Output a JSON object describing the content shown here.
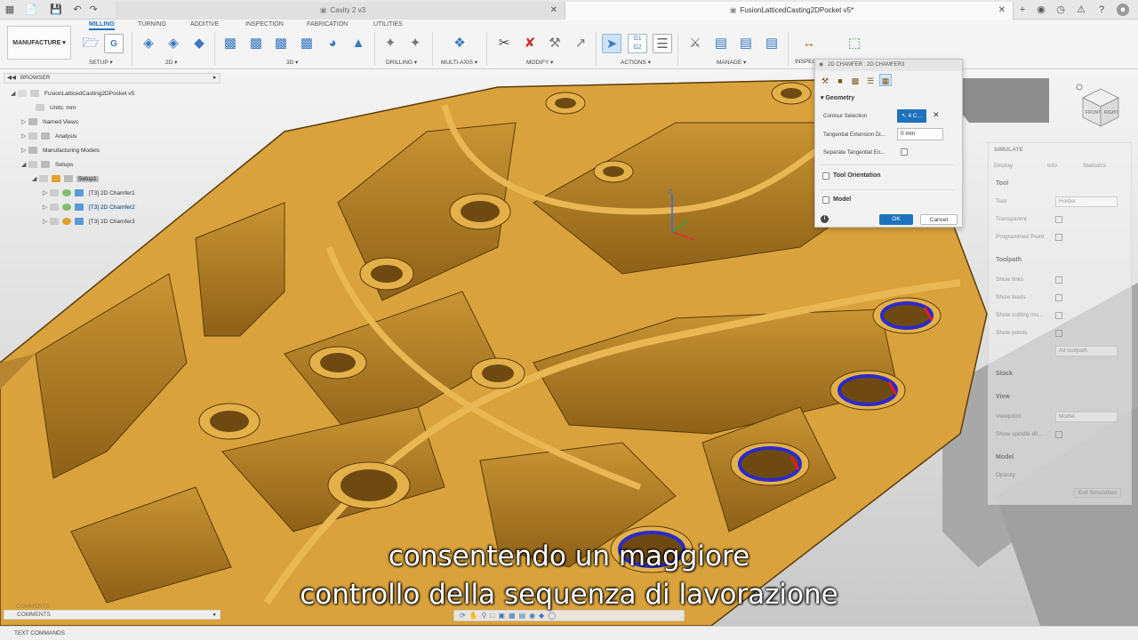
{
  "titlebar": {
    "inactive_tab": "Cavity 2 v3",
    "active_tab": "FusionLatticedCasting2DPocket v5*"
  },
  "ribbon": {
    "tabs": [
      "MILLING",
      "TURNING",
      "ADDITIVE",
      "INSPECTION",
      "FABRICATION",
      "UTILITIES"
    ],
    "workspace": "MANUFACTURE",
    "groups": [
      "SETUP",
      "2D",
      "3D",
      "DRILLING",
      "MULTI-AXIS",
      "MODIFY",
      "ACTIONS",
      "MANAGE",
      "INSPECT"
    ]
  },
  "browser": {
    "header": "BROWSER",
    "items": [
      "FusionLatticedCasting2DPocket v5",
      "Units: mm",
      "Named Views",
      "Analysis",
      "Manufacturing Models",
      "Setups",
      "Setup1",
      "[T3] 2D Chamfer1",
      "[T3] 2D Chamfer2",
      "[T3] 2D Chamfer3"
    ]
  },
  "dialog": {
    "title": "2D CHAMFER : 2D CHAMFER3",
    "section_geometry": "Geometry",
    "contour_label": "Contour Selection",
    "contour_value": "4 C...",
    "tangential_ext_label": "Tangential Extension Di...",
    "tangential_ext_value": "0 mm",
    "separate_label": "Separate Tangential En...",
    "tool_orientation": "Tool Orientation",
    "model": "Model",
    "ok": "OK",
    "cancel": "Cancel"
  },
  "simulate": {
    "title": "SIMULATE",
    "tabs": [
      "Display",
      "Info",
      "Statistics"
    ],
    "tool_section": "Tool",
    "tool_label": "Tool",
    "tool_value": "Holder",
    "transparent": "Transparent",
    "programmed_point": "Programmed Point",
    "toolpath_section": "Toolpath",
    "show_links": "Show links",
    "show_leads": "Show leads",
    "show_cutting": "Show cutting mo...",
    "show_points": "Show points",
    "mode_value": "All toolpath",
    "stock_section": "Stock",
    "view_section": "View",
    "viewpoint_label": "Viewpoint",
    "viewpoint_value": "Model",
    "show_spindle": "Show spindle dir...",
    "model_section": "Model",
    "opacity_label": "Opacity",
    "exit": "Exit Simulation"
  },
  "viewcube": {
    "front": "FRONT",
    "right": "RIGHT"
  },
  "bottom": {
    "comments": "COMMENTS",
    "text_commands": "TEXT COMMANDS"
  },
  "subtitles": {
    "line1": "consentendo un maggiore",
    "line2": "controllo della sequenza di lavorazione"
  },
  "colors": {
    "part": "#d9a23c",
    "part_dark": "#a87424",
    "contour_blue": "#2a2acb",
    "accent": "#1e73be"
  }
}
